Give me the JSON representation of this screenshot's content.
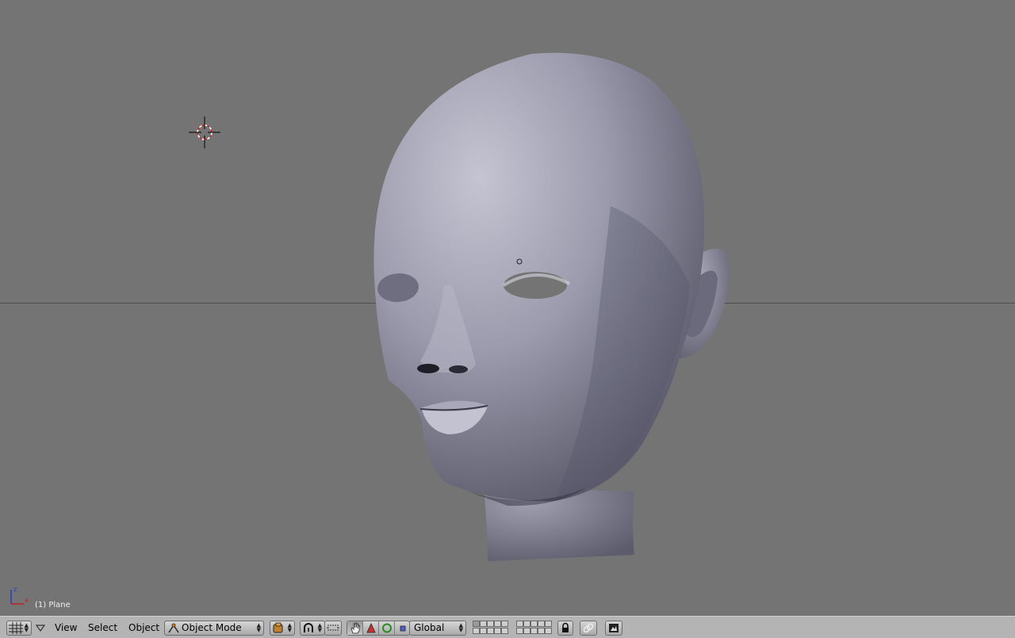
{
  "viewport": {
    "object_label": "(1) Plane",
    "axis_label": "z",
    "axis_label_x": "x"
  },
  "header": {
    "editor_type_icon": "viewport-grid-icon",
    "menus": {
      "view": "View",
      "select": "Select",
      "object": "Object"
    },
    "mode_label": "Object Mode",
    "orientation_label": "Global",
    "icons": [
      "viewport-grid-icon",
      "collapse-triangle-icon",
      "object-mode-icon",
      "draw-type-icon",
      "pivot-icon",
      "snap-icon",
      "hand-grab-icon",
      "translate-icon",
      "rotate-icon",
      "scale-icon",
      "layer-grid-icon",
      "lock-icon",
      "link-icon",
      "render-icon"
    ]
  },
  "colors": {
    "viewport_bg": "#747474",
    "header_bg": "#b4b4b4",
    "mesh": "#9a9aac"
  }
}
